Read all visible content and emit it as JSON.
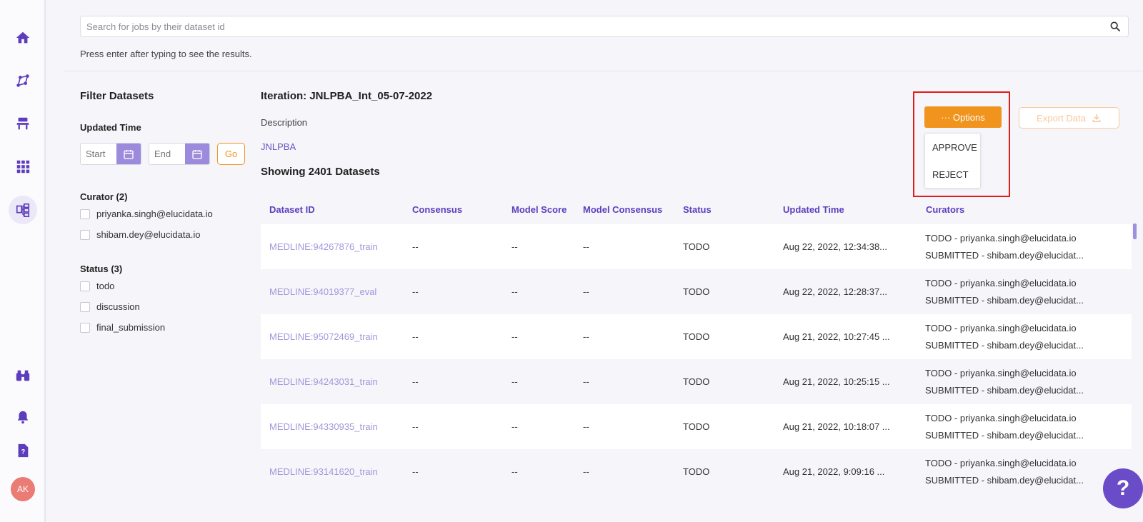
{
  "search": {
    "placeholder": "Search for jobs by their dataset id",
    "hint": "Press enter after typing to see the results."
  },
  "filters": {
    "title": "Filter Datasets",
    "updated_time_label": "Updated Time",
    "start_placeholder": "Start",
    "end_placeholder": "End",
    "go_label": "Go",
    "curator_label": "Curator (2)",
    "curators": [
      "priyanka.singh@elucidata.io",
      "shibam.dey@elucidata.io"
    ],
    "status_label": "Status (3)",
    "statuses": [
      "todo",
      "discussion",
      "final_submission"
    ]
  },
  "header": {
    "iteration": "Iteration: JNLPBA_Int_05-07-2022",
    "description_label": "Description",
    "description_value": "JNLPBA",
    "showing": "Showing 2401 Datasets"
  },
  "options": {
    "label": "··· Options",
    "items": [
      "APPROVE",
      "REJECT"
    ]
  },
  "export": {
    "label": "Export Data"
  },
  "table": {
    "columns": [
      "Dataset ID",
      "Consensus",
      "Model Score",
      "Model Consensus",
      "Status",
      "Updated Time",
      "Curators"
    ],
    "rows": [
      {
        "id": "MEDLINE:94267876_train",
        "consensus": "--",
        "model_score": "--",
        "model_consensus": "--",
        "status": "TODO",
        "updated": "Aug 22, 2022, 12:34:38...",
        "cur1": "TODO - priyanka.singh@elucidata.io",
        "cur2": "SUBMITTED - shibam.dey@elucidat..."
      },
      {
        "id": "MEDLINE:94019377_eval",
        "consensus": "--",
        "model_score": "--",
        "model_consensus": "--",
        "status": "TODO",
        "updated": "Aug 22, 2022, 12:28:37...",
        "cur1": "TODO - priyanka.singh@elucidata.io",
        "cur2": "SUBMITTED - shibam.dey@elucidat..."
      },
      {
        "id": "MEDLINE:95072469_train",
        "consensus": "--",
        "model_score": "--",
        "model_consensus": "--",
        "status": "TODO",
        "updated": "Aug 21, 2022, 10:27:45 ...",
        "cur1": "TODO - priyanka.singh@elucidata.io",
        "cur2": "SUBMITTED - shibam.dey@elucidat..."
      },
      {
        "id": "MEDLINE:94243031_train",
        "consensus": "--",
        "model_score": "--",
        "model_consensus": "--",
        "status": "TODO",
        "updated": "Aug 21, 2022, 10:25:15 ...",
        "cur1": "TODO - priyanka.singh@elucidata.io",
        "cur2": "SUBMITTED - shibam.dey@elucidat..."
      },
      {
        "id": "MEDLINE:94330935_train",
        "consensus": "--",
        "model_score": "--",
        "model_consensus": "--",
        "status": "TODO",
        "updated": "Aug 21, 2022, 10:18:07 ...",
        "cur1": "TODO - priyanka.singh@elucidata.io",
        "cur2": "SUBMITTED - shibam.dey@elucidat..."
      },
      {
        "id": "MEDLINE:93141620_train",
        "consensus": "--",
        "model_score": "--",
        "model_consensus": "--",
        "status": "TODO",
        "updated": "Aug 21, 2022, 9:09:16 ...",
        "cur1": "TODO - priyanka.singh@elucidata.io",
        "cur2": "SUBMITTED - shibam.dey@elucidat..."
      }
    ]
  },
  "user": {
    "initials": "AK"
  },
  "help": {
    "label": "?"
  },
  "colors": {
    "accent": "#5b3fbf",
    "orange": "#f0941d",
    "highlight": "#e21b1b"
  }
}
